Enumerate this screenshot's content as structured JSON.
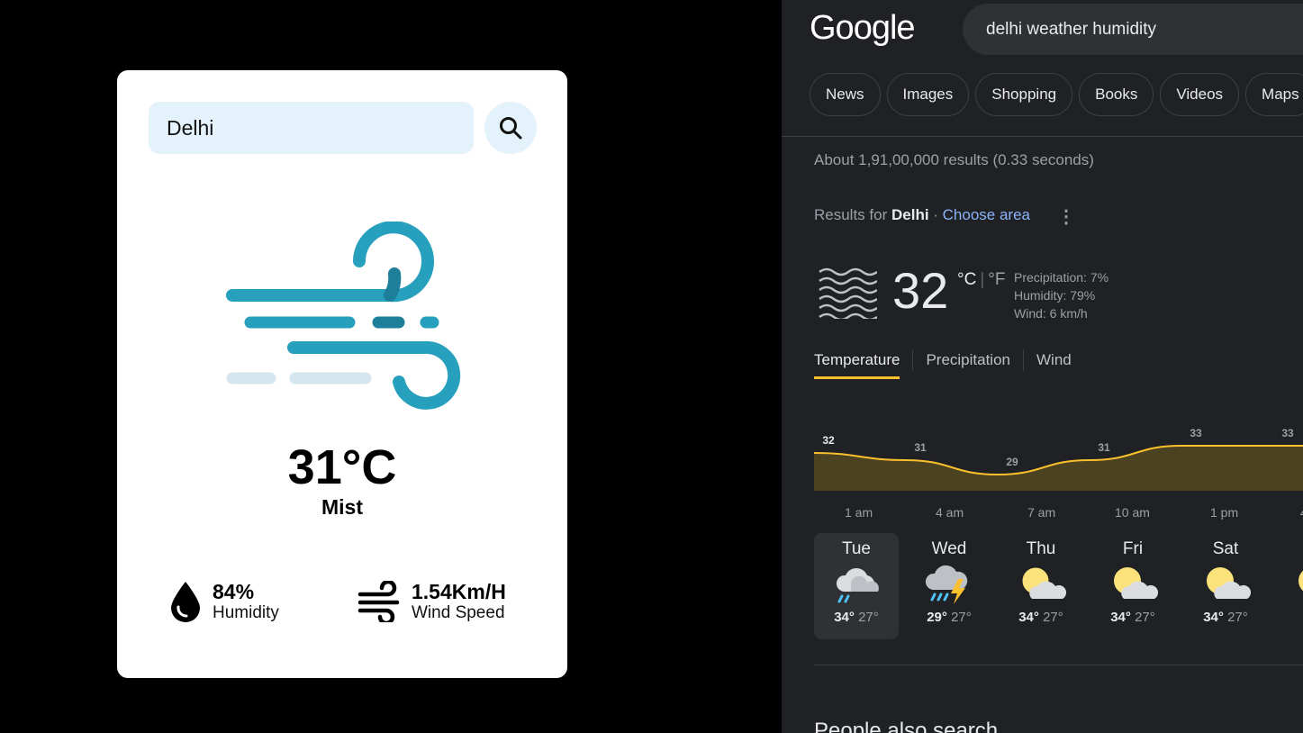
{
  "weather_app": {
    "search_value": "Delhi",
    "temperature": "31°C",
    "condition": "Mist",
    "humidity_value": "84%",
    "humidity_label": "Humidity",
    "wind_value": "1.54Km/H",
    "wind_label": "Wind Speed",
    "icons": {
      "search": "search-icon",
      "main": "wind-icon",
      "humidity": "water-drop-icon",
      "wind": "wind-icon"
    },
    "colors": {
      "accent": "#27a0be",
      "input_bg": "#e4f2fb"
    }
  },
  "google": {
    "logo": "Google",
    "query": "delhi weather humidity",
    "chips": [
      "News",
      "Images",
      "Shopping",
      "Books",
      "Videos",
      "Maps"
    ],
    "result_stats": "About 1,91,00,000 results (0.33 seconds)",
    "results_for_prefix": "Results for",
    "results_for_place": "Delhi",
    "choose_area": "Choose area",
    "current": {
      "temp": "32",
      "unit_c": "°C",
      "unit_f": "°F",
      "precipitation": "Precipitation: 7%",
      "humidity": "Humidity: 79%",
      "wind": "Wind: 6 km/h"
    },
    "tabs": [
      "Temperature",
      "Precipitation",
      "Wind"
    ],
    "hours": [
      "1 am",
      "4 am",
      "7 am",
      "10 am",
      "1 pm",
      "4"
    ],
    "days": [
      {
        "name": "Tue",
        "high": "34°",
        "low": "27°",
        "icon": "rain-cloud-icon"
      },
      {
        "name": "Wed",
        "high": "29°",
        "low": "27°",
        "icon": "thunderstorm-icon"
      },
      {
        "name": "Thu",
        "high": "34°",
        "low": "27°",
        "icon": "partly-cloudy-icon"
      },
      {
        "name": "Fri",
        "high": "34°",
        "low": "27°",
        "icon": "partly-cloudy-icon"
      },
      {
        "name": "Sat",
        "high": "34°",
        "low": "27°",
        "icon": "partly-cloudy-icon"
      },
      {
        "name": "S",
        "high": "3",
        "low": "",
        "icon": "partly-cloudy-icon"
      }
    ],
    "bottom_heading_partial": "People also search"
  },
  "chart_data": {
    "type": "area",
    "x": [
      "1 am",
      "4 am",
      "7 am",
      "10 am",
      "1 pm",
      "4 pm"
    ],
    "values": [
      32,
      31,
      29,
      31,
      33,
      33
    ],
    "line_color": "#fbc02d",
    "fill_color": "#4a4220"
  }
}
